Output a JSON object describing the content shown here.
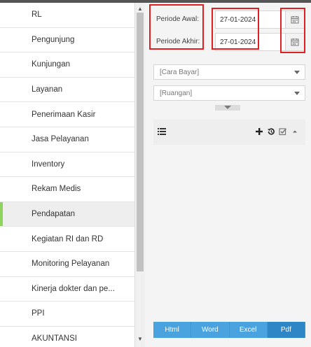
{
  "sidebar": {
    "items": [
      {
        "label": "RL"
      },
      {
        "label": "Pengunjung"
      },
      {
        "label": "Kunjungan"
      },
      {
        "label": "Layanan"
      },
      {
        "label": "Penerimaan Kasir"
      },
      {
        "label": "Jasa Pelayanan"
      },
      {
        "label": "Inventory"
      },
      {
        "label": "Rekam Medis"
      },
      {
        "label": "Pendapatan"
      },
      {
        "label": "Kegiatan RI dan RD"
      },
      {
        "label": "Monitoring Pelayanan"
      },
      {
        "label": "Kinerja dokter dan pe..."
      },
      {
        "label": "PPI"
      },
      {
        "label": "AKUNTANSI"
      }
    ],
    "active_index": 8,
    "accent_color": "#8ed35e"
  },
  "filters": {
    "periode_awal_label": "Periode Awal:",
    "periode_awal_value": "27-01-2024",
    "periode_akhir_label": "Periode Akhir:",
    "periode_akhir_value": "27-01-2024",
    "cara_bayar_placeholder": "[Cara Bayar]",
    "ruangan_placeholder": "[Ruangan]"
  },
  "export": {
    "html_label": "Html",
    "word_label": "Word",
    "excel_label": "Excel",
    "pdf_label": "Pdf",
    "button_color": "#4aa3df"
  },
  "highlight_color": "#e02020",
  "icons": [
    "calendar-icon",
    "list-icon",
    "plus-icon",
    "history-icon",
    "check-square-icon",
    "chevron-up-icon"
  ]
}
